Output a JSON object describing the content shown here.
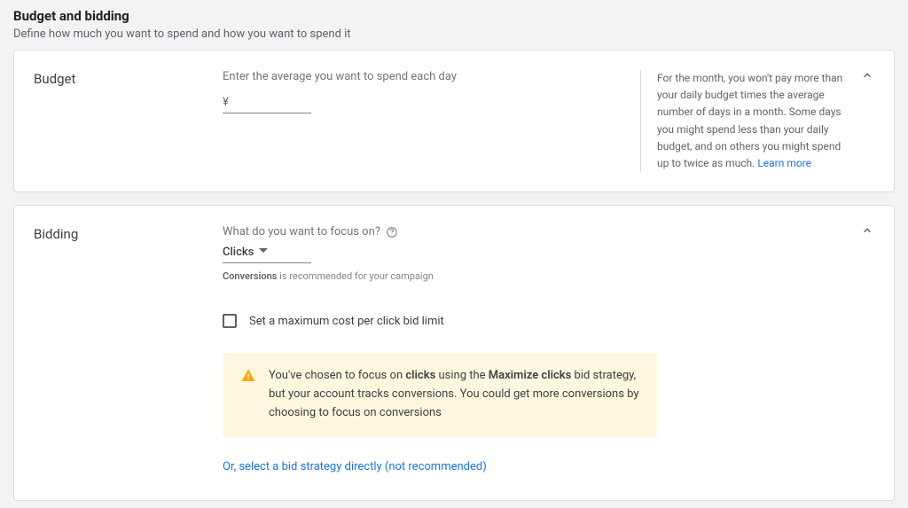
{
  "header": {
    "title": "Budget and bidding",
    "subtitle": "Define how much you want to spend and how you want to spend it"
  },
  "budget": {
    "label": "Budget",
    "prompt": "Enter the average you want to spend each day",
    "currency": "¥",
    "value": "",
    "info_text": "For the month, you won't pay more than your daily budget times the average number of days in a month. Some days you might spend less than your daily budget, and on others you might spend up to twice as much.",
    "learn_more": "Learn more"
  },
  "bidding": {
    "label": "Bidding",
    "focus_label": "What do you want to focus on?",
    "focus_value": "Clicks",
    "recommend_bold": "Conversions",
    "recommend_rest": " is recommended for your campaign",
    "checkbox_label": "Set a maximum cost per click bid limit",
    "checkbox_checked": false,
    "notice_pre": "You've chosen to focus on ",
    "notice_b1": "clicks",
    "notice_mid": " using the ",
    "notice_b2": "Maximize clicks",
    "notice_post": " bid strategy, but your account tracks conversions. You could get more conversions by choosing to focus on conversions",
    "direct_link": "Or, select a bid strategy directly (not recommended)"
  }
}
